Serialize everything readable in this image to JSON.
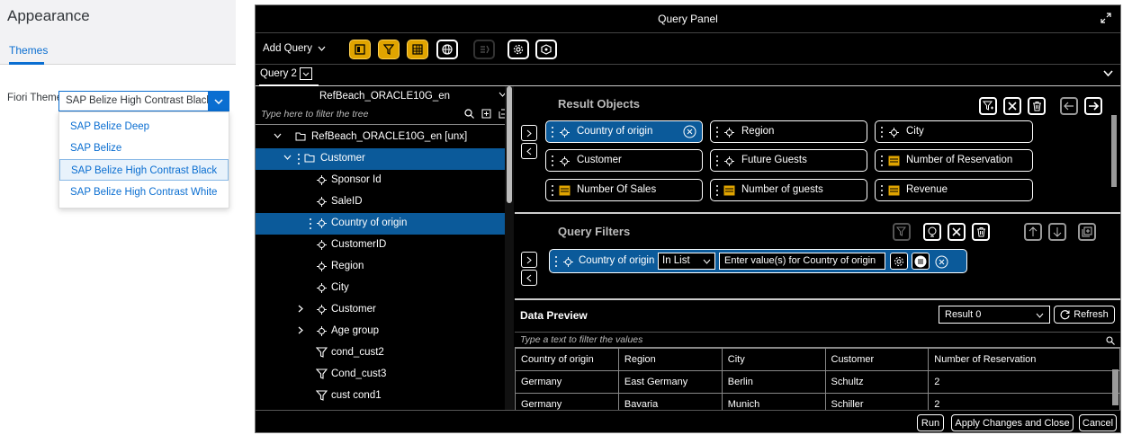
{
  "settings": {
    "title": "Appearance",
    "tab": "Themes",
    "theme_label": "Fiori Theme",
    "selected_theme": "SAP Belize High Contrast Black",
    "options": [
      "SAP Belize Deep",
      "SAP Belize",
      "SAP Belize High Contrast Black",
      "SAP Belize High Contrast White"
    ]
  },
  "query_panel": {
    "title": "Query Panel",
    "add_query": "Add Query",
    "query_tab": "Query 2",
    "universe": "RefBeach_ORACLE10G_en",
    "tree_filter_placeholder": "Type here to filter the tree",
    "tree": [
      {
        "label": "RefBeach_ORACLE10G_en [unx]",
        "type": "folder",
        "expanded": true
      },
      {
        "label": "Customer",
        "type": "folder",
        "expanded": true,
        "selected": true
      },
      {
        "label": "Sponsor Id",
        "type": "dimension"
      },
      {
        "label": "SaleID",
        "type": "dimension"
      },
      {
        "label": "Country of origin",
        "type": "dimension",
        "selected": true
      },
      {
        "label": "CustomerID",
        "type": "dimension"
      },
      {
        "label": "Region",
        "type": "dimension"
      },
      {
        "label": "City",
        "type": "dimension"
      },
      {
        "label": "Customer",
        "type": "dimension",
        "collapsed": true
      },
      {
        "label": "Age group",
        "type": "dimension",
        "collapsed": true
      },
      {
        "label": "cond_cust2",
        "type": "filter"
      },
      {
        "label": "Cond_cust3",
        "type": "filter"
      },
      {
        "label": "cust cond1",
        "type": "filter"
      }
    ],
    "result_objects": {
      "title": "Result Objects",
      "items": [
        {
          "label": "Country of origin",
          "type": "dimension",
          "selected": true
        },
        {
          "label": "Region",
          "type": "dimension"
        },
        {
          "label": "City",
          "type": "dimension"
        },
        {
          "label": "Customer",
          "type": "dimension"
        },
        {
          "label": "Future Guests",
          "type": "dimension"
        },
        {
          "label": "Number of Reservation",
          "type": "measure"
        },
        {
          "label": "Number Of Sales",
          "type": "measure"
        },
        {
          "label": "Number of guests",
          "type": "measure"
        },
        {
          "label": "Revenue",
          "type": "measure"
        }
      ]
    },
    "query_filters": {
      "title": "Query Filters",
      "filter": {
        "object": "Country of origin",
        "operator": "In List",
        "value": "Enter value(s) for Country of origin"
      }
    },
    "data_preview": {
      "title": "Data Preview",
      "result_select": "Result 0",
      "refresh": "Refresh",
      "filter_placeholder": "Type a text to filter the values",
      "columns": [
        "Country of origin",
        "Region",
        "City",
        "Customer",
        "Number of Reservation"
      ],
      "rows": [
        [
          "Germany",
          "East Germany",
          "Berlin",
          "Schultz",
          "2"
        ],
        [
          "Germany",
          "Bavaria",
          "Munich",
          "Schiller",
          "2"
        ]
      ]
    },
    "footer": {
      "run": "Run",
      "apply": "Apply Changes and Close",
      "cancel": "Cancel"
    }
  },
  "colors": {
    "accent": "#0a6ed1",
    "selected_dark": "#0b5a9a",
    "toolbar_active": "#e0a400",
    "measure_icon": "#e0a400"
  }
}
